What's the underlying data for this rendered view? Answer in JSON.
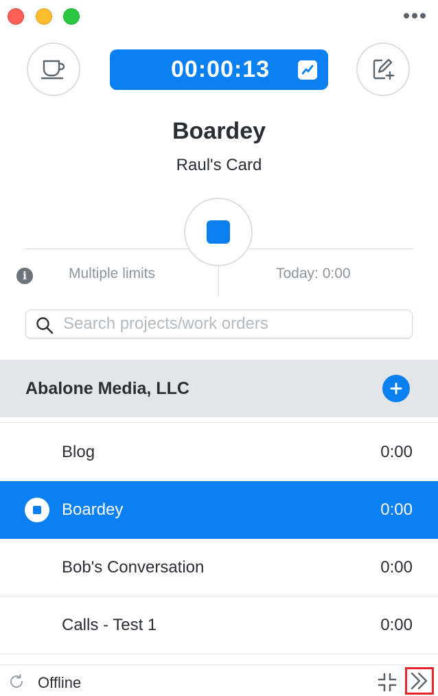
{
  "window": {
    "controls": [
      "close",
      "minimize",
      "zoom"
    ],
    "more_icon": "more-horizontal-icon"
  },
  "toolbar": {
    "break_icon": "coffee-cup-icon",
    "timer": "00:00:13",
    "timer_icon": "checkbox-chart-icon",
    "edit_icon": "edit-note-icon"
  },
  "project": {
    "title": "Boardey",
    "card": "Raul's Card"
  },
  "limits": {
    "label": "Multiple limits",
    "today": "Today: 0:00",
    "info_icon": "info-icon",
    "stop_icon": "stop-icon"
  },
  "search": {
    "placeholder": "Search projects/work orders",
    "value": ""
  },
  "client": {
    "name": "Abalone Media, LLC",
    "add_icon": "plus-icon"
  },
  "projects": [
    {
      "name": "Blog",
      "time": "0:00",
      "active": false
    },
    {
      "name": "Boardey",
      "time": "0:00",
      "active": true
    },
    {
      "name": "Bob's Conversation",
      "time": "0:00",
      "active": false
    },
    {
      "name": "Calls - Test 1",
      "time": "0:00",
      "active": false
    }
  ],
  "footer": {
    "status": "Offline",
    "refresh_icon": "refresh-icon",
    "collapse_icon": "collapse-icon",
    "expand_icon": "double-chevron-right-icon"
  },
  "colors": {
    "accent": "#0a7ff0",
    "header_bg": "#e3e5e8",
    "highlight_border": "#e8232b"
  }
}
